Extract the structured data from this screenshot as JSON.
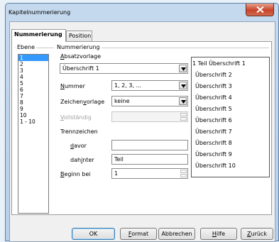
{
  "window": {
    "title": "Kapitelnummerierung"
  },
  "tabs": [
    {
      "label": "Nummerierung",
      "active": true
    },
    {
      "label": "Position",
      "active": false
    }
  ],
  "level": {
    "group_label": "Ebene",
    "items": [
      "1",
      "2",
      "3",
      "4",
      "5",
      "6",
      "7",
      "8",
      "9",
      "10",
      "1 - 10"
    ],
    "selected": "1"
  },
  "numbering": {
    "group_label": "Nummerierung",
    "paragraph_style": {
      "label": "Absatzvorlage",
      "value": "Überschrift 1"
    },
    "number": {
      "label": "Nummer",
      "value": "1, 2, 3, ..."
    },
    "char_style": {
      "label": "Zeichenvorlage",
      "value": "keine"
    },
    "complete": {
      "label": "Vollständig",
      "value": ""
    },
    "separator": {
      "label": "Trennzeichen"
    },
    "before": {
      "label": "davor",
      "value": ""
    },
    "after": {
      "label": "dahinter",
      "value": "Teil"
    },
    "start_at": {
      "label": "Beginn bei",
      "value": "1"
    }
  },
  "preview": [
    "1 Teil Überschrift 1",
    "Überschrift 2",
    "Überschrift 3",
    "Überschrift 4",
    "Überschrift 5",
    "Überschrift 6",
    "Überschrift 7",
    "Überschrift 8",
    "Überschrift 9",
    "Überschrift 10"
  ],
  "buttons": {
    "ok": "OK",
    "format": "Format",
    "cancel": "Abbrechen",
    "help": "Hilfe",
    "back": "Zurück"
  },
  "colors": {
    "selection": "#3399ff",
    "close_button": "#c7452a"
  }
}
